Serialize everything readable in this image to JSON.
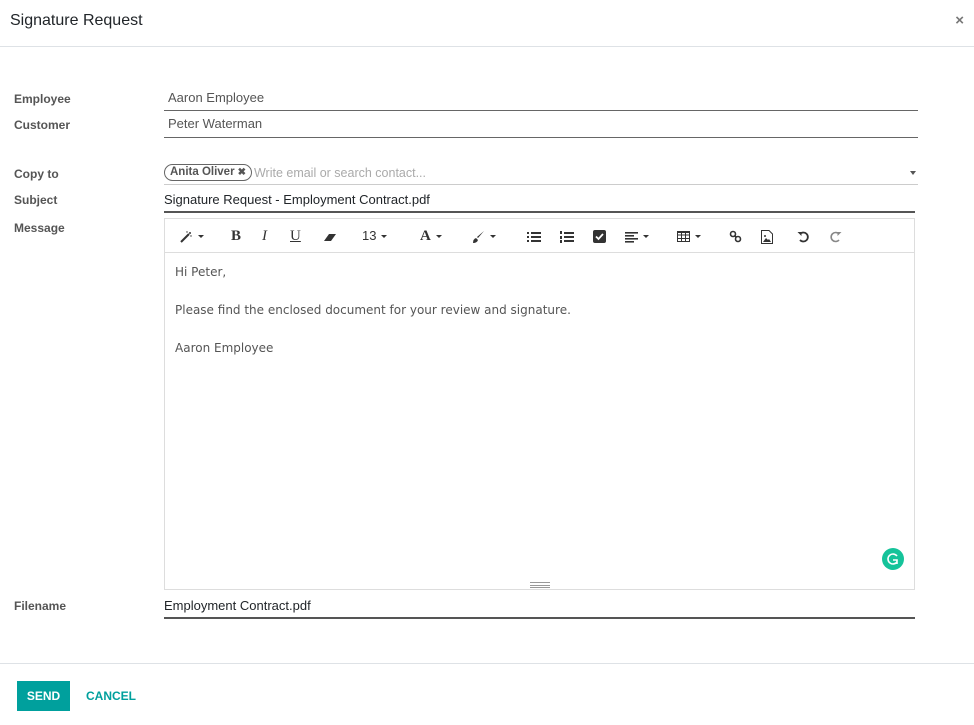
{
  "dialog": {
    "title": "Signature Request",
    "close_icon": "×"
  },
  "form": {
    "employee_label": "Employee",
    "employee_value": "Aaron Employee",
    "customer_label": "Customer",
    "customer_value": "Peter Waterman",
    "copy_to_label": "Copy to",
    "copy_to_tags": [
      "Anita Oliver"
    ],
    "copy_to_placeholder": "Write email or search contact...",
    "subject_label": "Subject",
    "subject_value": "Signature Request - Employment Contract.pdf",
    "message_label": "Message",
    "filename_label": "Filename",
    "filename_value": "Employment Contract.pdf"
  },
  "editor": {
    "toolbar": {
      "magic": "magic-wand-icon",
      "bold": "B",
      "italic": "I",
      "underline": "U",
      "eraser": "eraser-icon",
      "font_size": "13",
      "font_color": "A",
      "paint": "paint-brush-icon",
      "ul": "unordered-list-icon",
      "ol": "ordered-list-icon",
      "checklist": "checklist-icon",
      "align": "align-icon",
      "table": "table-icon",
      "link": "link-icon",
      "image": "image-icon",
      "undo": "undo-icon",
      "redo": "redo-icon"
    },
    "body": [
      "Hi Peter,",
      "Please find the enclosed document for your review and signature.",
      "Aaron Employee"
    ]
  },
  "footer": {
    "send_label": "SEND",
    "cancel_label": "CANCEL"
  }
}
